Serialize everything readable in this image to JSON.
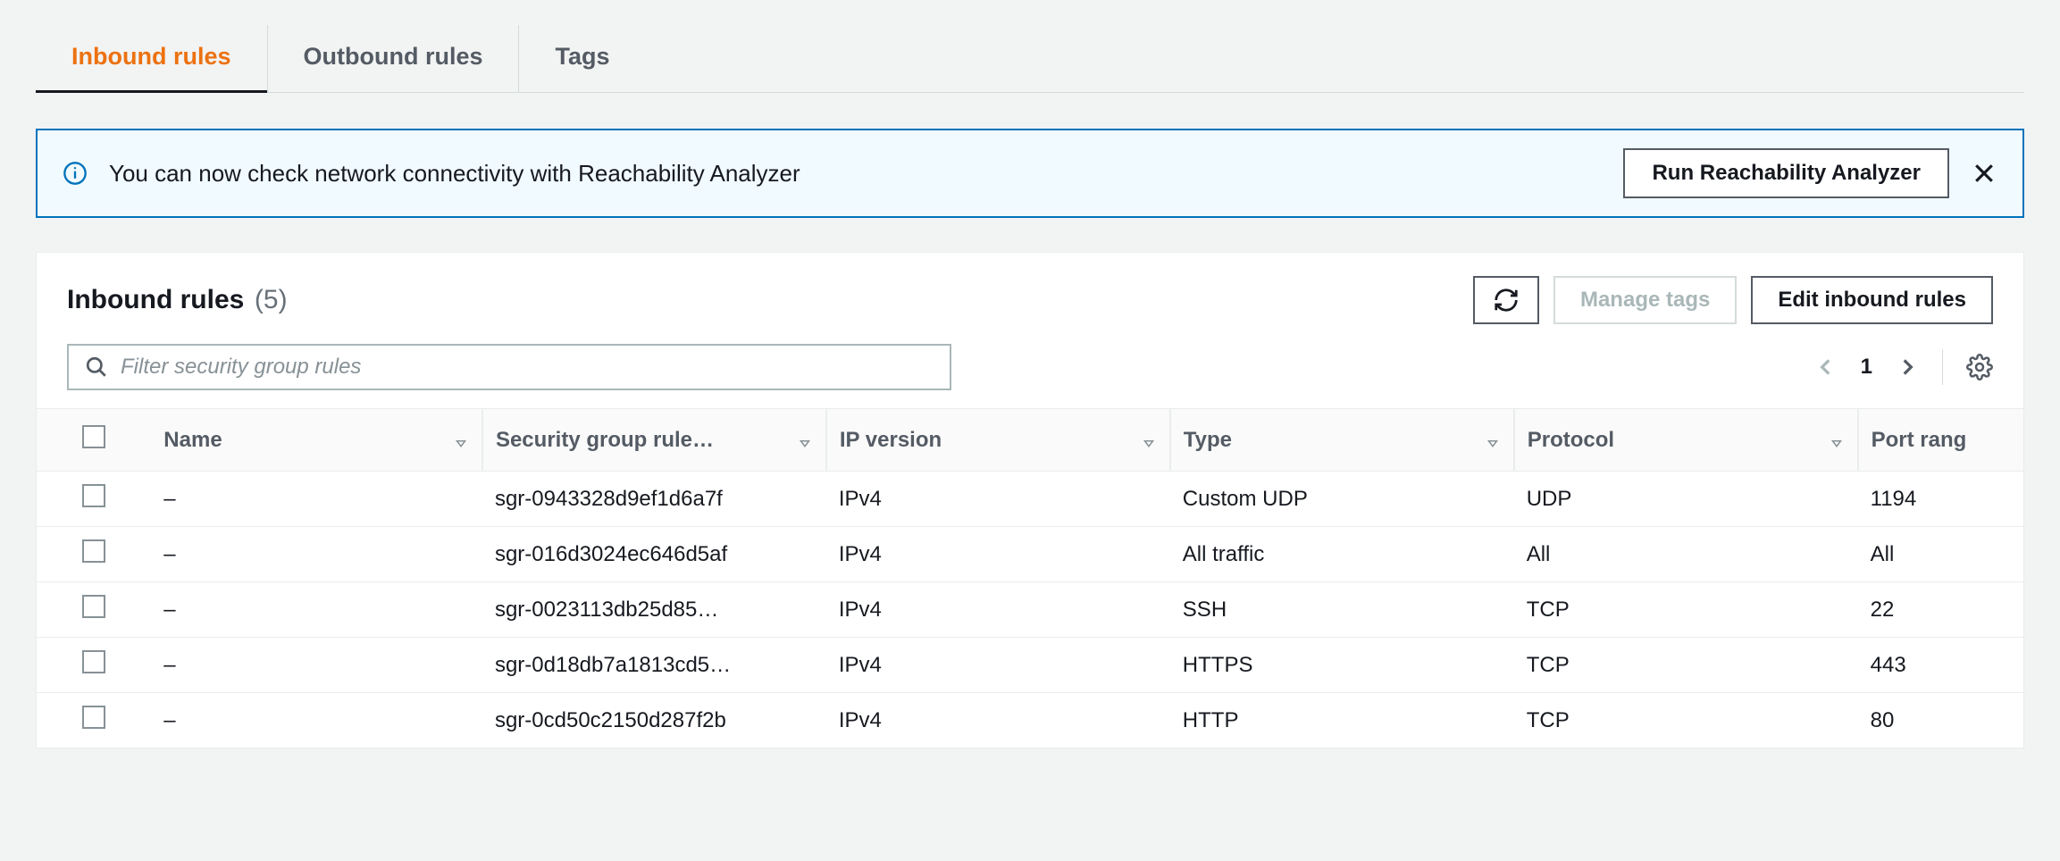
{
  "tabs": [
    {
      "label": "Inbound rules",
      "active": true
    },
    {
      "label": "Outbound rules",
      "active": false
    },
    {
      "label": "Tags",
      "active": false
    }
  ],
  "banner": {
    "text": "You can now check network connectivity with Reachability Analyzer",
    "button": "Run Reachability Analyzer"
  },
  "panel": {
    "title": "Inbound rules",
    "count": "(5)",
    "manage_tags": "Manage tags",
    "edit_button": "Edit inbound rules"
  },
  "search": {
    "placeholder": "Filter security group rules"
  },
  "pager": {
    "page": "1"
  },
  "columns": {
    "name": "Name",
    "sgr": "Security group rule…",
    "ipv": "IP version",
    "type": "Type",
    "proto": "Protocol",
    "port": "Port rang"
  },
  "rows": [
    {
      "name": "–",
      "sgr": "sgr-0943328d9ef1d6a7f",
      "ipv": "IPv4",
      "type": "Custom UDP",
      "proto": "UDP",
      "port": "1194"
    },
    {
      "name": "–",
      "sgr": "sgr-016d3024ec646d5af",
      "ipv": "IPv4",
      "type": "All traffic",
      "proto": "All",
      "port": "All"
    },
    {
      "name": "–",
      "sgr": "sgr-0023113db25d85…",
      "ipv": "IPv4",
      "type": "SSH",
      "proto": "TCP",
      "port": "22"
    },
    {
      "name": "–",
      "sgr": "sgr-0d18db7a1813cd5…",
      "ipv": "IPv4",
      "type": "HTTPS",
      "proto": "TCP",
      "port": "443"
    },
    {
      "name": "–",
      "sgr": "sgr-0cd50c2150d287f2b",
      "ipv": "IPv4",
      "type": "HTTP",
      "proto": "TCP",
      "port": "80"
    }
  ]
}
